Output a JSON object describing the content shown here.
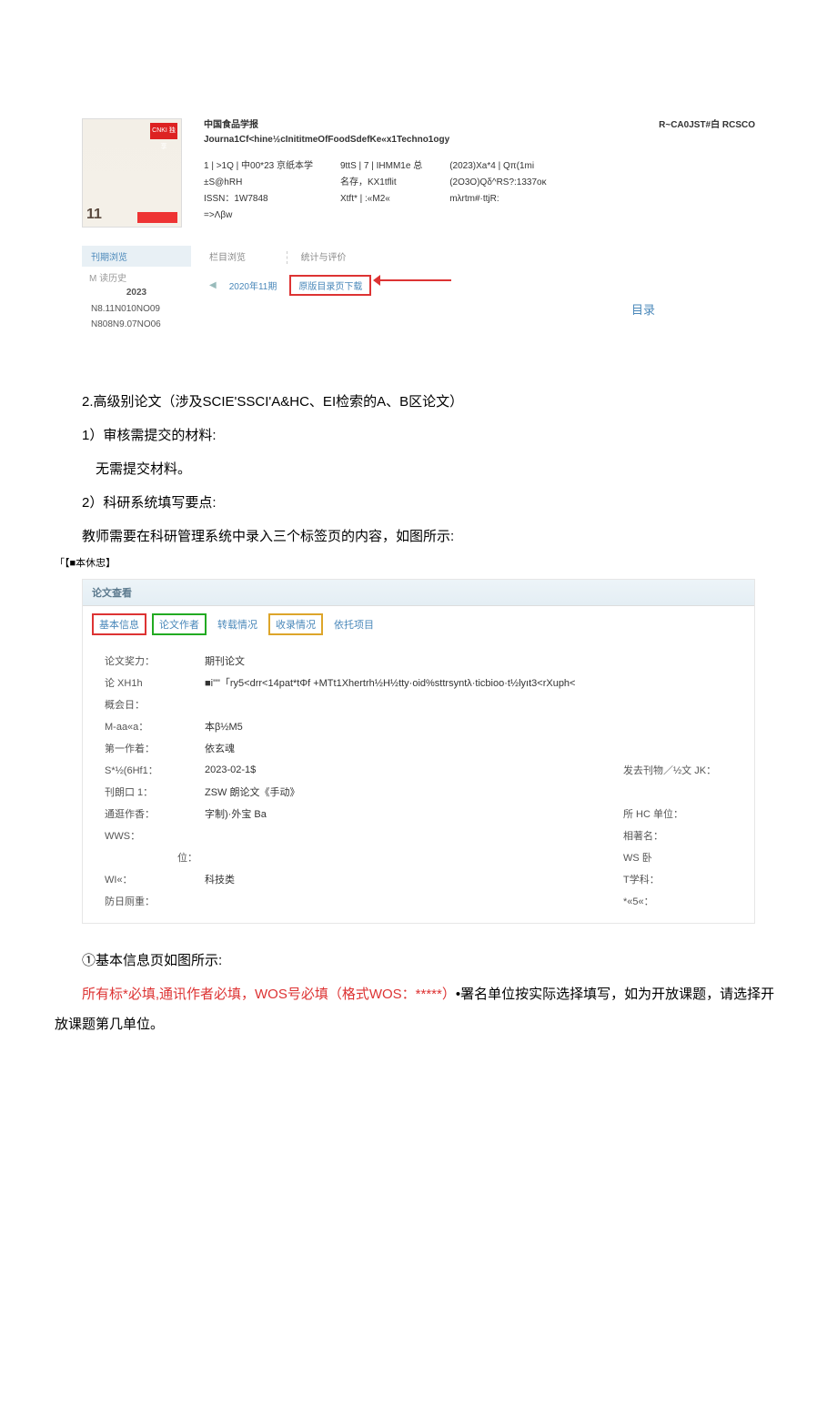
{
  "journal": {
    "cover_ribbon": "CNKI 独享",
    "cover_issue": "11",
    "title_cn": "中国食品学报",
    "title_en": "Journa1Cf<hine½cInititmeOfFoodSdefKe«x1Techno1ogy",
    "db_label": "R~CA0JST#白 RCSCO",
    "col1_l1": "1 | >1Q | 中00*23 京纸本学",
    "col1_l2": "±S@hRH",
    "col1_l3": "ISSN：1W7848",
    "col1_l4": "=>Λβw",
    "col2_l1": "9ttS | 7 | IHMM1e 总",
    "col2_l2": "名存，KX1tflit",
    "col2_l3": "Xtft* | :«M2«",
    "col3_l1": "(2023)Xa*4 | Qπ(1mi",
    "col3_l2": "(2O3O)Qδ^RS?:1337oκ",
    "col3_l3": "mλrtm#·ttjR:",
    "nav_hdr": " 刊期浏览",
    "nav_m": "M 读历史",
    "nav_year": "2023",
    "nav_nos1": "N8.11N010NO09",
    "nav_nos2": "N808N9.07NO06",
    "browse_tab1": "栏目浏览",
    "browse_tab2": "统计与评价",
    "issue_label": "2020年11期",
    "download_label": "原版目录页下载",
    "mulu": "目录"
  },
  "body": {
    "p1": "2.高级别论文（涉及SCIE'SSCI'A&HC、EI检索的A、B区论文）",
    "p2": "1）审核需提交的材料:",
    "p3": "无需提交材料。",
    "p4": "2）科研系统填写要点:",
    "p5": "教师需要在科研管理系统中录入三个标签页的内容，如图所示:",
    "p5_label": "「【■本休忠】",
    "p6": "①基本信息页如图所示:",
    "p7a": "所有标*必填,通讯作者必填，WOS号必填（格式WOS：*****）",
    "p7b": "•署名单位按实际选择填写，如为开放课题，请选择开放课题第几单位。"
  },
  "form": {
    "header": "论文查看",
    "tabs": {
      "t1": "基本信息",
      "t2": "论文作者",
      "t3": "转载情况",
      "t4": "收录情况",
      "t5": "依托项目"
    },
    "rows": {
      "r1l": "论文奖力：",
      "r1v": "期刊论文",
      "r2l": "论 XH1h",
      "r2v": "■i\"\"「ry5<drr<14pat*tΦf      +MTt1Xhertrh½H½tty·oid%sttrsyntλ·ticbioo·t½lyıt3<rXuph<",
      "r3l": "概会日：",
      "r3v": "",
      "r4l": "M-aa«a：",
      "r4v": "本β½M5",
      "r5l": "第一作着：",
      "r5v": "依玄魂",
      "r6l": "S*½(6Hf1：",
      "r6v": "2023-02-1$",
      "r6r": "发去刊物／½文 JK：",
      "r7l": "刊朗口 1：",
      "r7v": "ZSW 朗论文《手动》",
      "r8l": "通逛作香：",
      "r8v": "字制)·外宝 Ba",
      "r8r": "所 HC 单位：",
      "r9l": "WWS：",
      "r9v": "",
      "r9r": "相著名：",
      "r10l": "位：",
      "r10v": "",
      "r10r": "WS 卧",
      "r11l": "WI«：",
      "r11v": "科技类",
      "r11r": "T学科：",
      "r12l": "防日厕重：",
      "r12v": "",
      "r12r": "*«5«："
    }
  }
}
